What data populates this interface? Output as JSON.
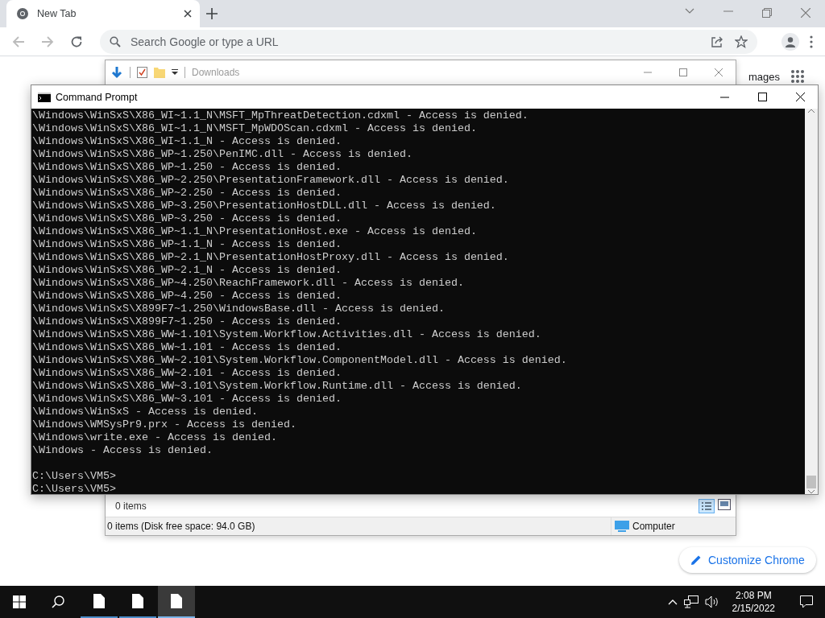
{
  "browser": {
    "tabs": [
      {
        "label": "New Tab",
        "selected": true
      }
    ],
    "address_bar": {
      "placeholder": "Search Google or type a URL"
    },
    "page": {
      "link": "mages",
      "customize_button": "Customize Chrome"
    }
  },
  "explorer": {
    "title": "Downloads",
    "item_count": "0 items",
    "status": "0 items (Disk free space: 94.0 GB)",
    "location": "Computer"
  },
  "command_prompt": {
    "title": "Command Prompt",
    "output_lines": [
      "\\Windows\\WinSxS\\X86_WI~1.1_N\\MSFT_MpThreatDetection.cdxml - Access is denied.",
      "\\Windows\\WinSxS\\X86_WI~1.1_N\\MSFT_MpWDOScan.cdxml - Access is denied.",
      "\\Windows\\WinSxS\\X86_WI~1.1_N - Access is denied.",
      "\\Windows\\WinSxS\\X86_WP~1.250\\PenIMC.dll - Access is denied.",
      "\\Windows\\WinSxS\\X86_WP~1.250 - Access is denied.",
      "\\Windows\\WinSxS\\X86_WP~2.250\\PresentationFramework.dll - Access is denied.",
      "\\Windows\\WinSxS\\X86_WP~2.250 - Access is denied.",
      "\\Windows\\WinSxS\\X86_WP~3.250\\PresentationHostDLL.dll - Access is denied.",
      "\\Windows\\WinSxS\\X86_WP~3.250 - Access is denied.",
      "\\Windows\\WinSxS\\X86_WP~1.1_N\\PresentationHost.exe - Access is denied.",
      "\\Windows\\WinSxS\\X86_WP~1.1_N - Access is denied.",
      "\\Windows\\WinSxS\\X86_WP~2.1_N\\PresentationHostProxy.dll - Access is denied.",
      "\\Windows\\WinSxS\\X86_WP~2.1_N - Access is denied.",
      "\\Windows\\WinSxS\\X86_WP~4.250\\ReachFramework.dll - Access is denied.",
      "\\Windows\\WinSxS\\X86_WP~4.250 - Access is denied.",
      "\\Windows\\WinSxS\\X899F7~1.250\\WindowsBase.dll - Access is denied.",
      "\\Windows\\WinSxS\\X899F7~1.250 - Access is denied.",
      "\\Windows\\WinSxS\\X86_WW~1.101\\System.Workflow.Activities.dll - Access is denied.",
      "\\Windows\\WinSxS\\X86_WW~1.101 - Access is denied.",
      "\\Windows\\WinSxS\\X86_WW~2.101\\System.Workflow.ComponentModel.dll - Access is denied.",
      "\\Windows\\WinSxS\\X86_WW~2.101 - Access is denied.",
      "\\Windows\\WinSxS\\X86_WW~3.101\\System.Workflow.Runtime.dll - Access is denied.",
      "\\Windows\\WinSxS\\X86_WW~3.101 - Access is denied.",
      "\\Windows\\WinSxS - Access is denied.",
      "\\Windows\\WMSysPr9.prx - Access is denied.",
      "\\Windows\\write.exe - Access is denied.",
      "\\Windows - Access is denied."
    ],
    "prompt_lines": [
      "C:\\Users\\VM5>",
      "C:\\Users\\VM5>"
    ]
  },
  "taskbar": {
    "apps": [
      {
        "selected": false
      },
      {
        "selected": false
      },
      {
        "selected": true
      }
    ],
    "time": "2:08 PM",
    "date": "2/15/2022"
  }
}
